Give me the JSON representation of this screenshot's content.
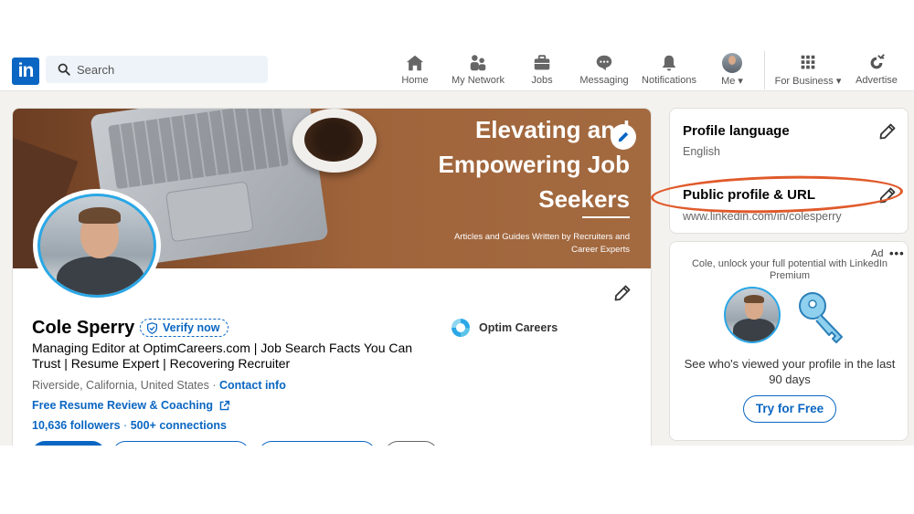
{
  "nav": {
    "logo_text": "in",
    "search_placeholder": "Search",
    "items": [
      {
        "label": "Home",
        "icon": "home-icon"
      },
      {
        "label": "My Network",
        "icon": "network-icon"
      },
      {
        "label": "Jobs",
        "icon": "briefcase-icon"
      },
      {
        "label": "Messaging",
        "icon": "message-icon"
      },
      {
        "label": "Notifications",
        "icon": "bell-icon"
      },
      {
        "label": "Me",
        "icon": "avatar-icon"
      },
      {
        "label": "For Business",
        "icon": "grid-icon"
      },
      {
        "label": "Advertise",
        "icon": "advertise-icon"
      }
    ]
  },
  "banner": {
    "title": "Elevating and Empowering Job Seekers",
    "subtitle": "Articles and Guides Written by Recruiters and Career Experts"
  },
  "profile": {
    "name": "Cole Sperry",
    "verify_label": "Verify now",
    "headline": "Managing Editor at OptimCareers.com | Job Search Facts You Can Trust | Resume Expert | Recovering Recruiter",
    "location": "Riverside, California, United States",
    "location_sep": " · ",
    "contact_label": "Contact info",
    "website_label": "Free Resume Review & Coaching",
    "followers": "10,636 followers",
    "connections": "500+ connections",
    "stats_sep": " · ",
    "company": "Optim Careers"
  },
  "sidebar": {
    "language_title": "Profile language",
    "language_value": "English",
    "url_title": "Public profile & URL",
    "url_value": "www.linkedin.com/in/colesperry"
  },
  "ad": {
    "label": "Ad",
    "more": "•••",
    "promo_line": "Cole, unlock your full potential with LinkedIn Premium",
    "message": "See who's viewed your profile in the last 90 days",
    "cta": "Try for Free"
  },
  "colors": {
    "brand": "#0a66c2",
    "annotation": "#e05a2b",
    "avatar_ring": "#2aa7e6"
  }
}
